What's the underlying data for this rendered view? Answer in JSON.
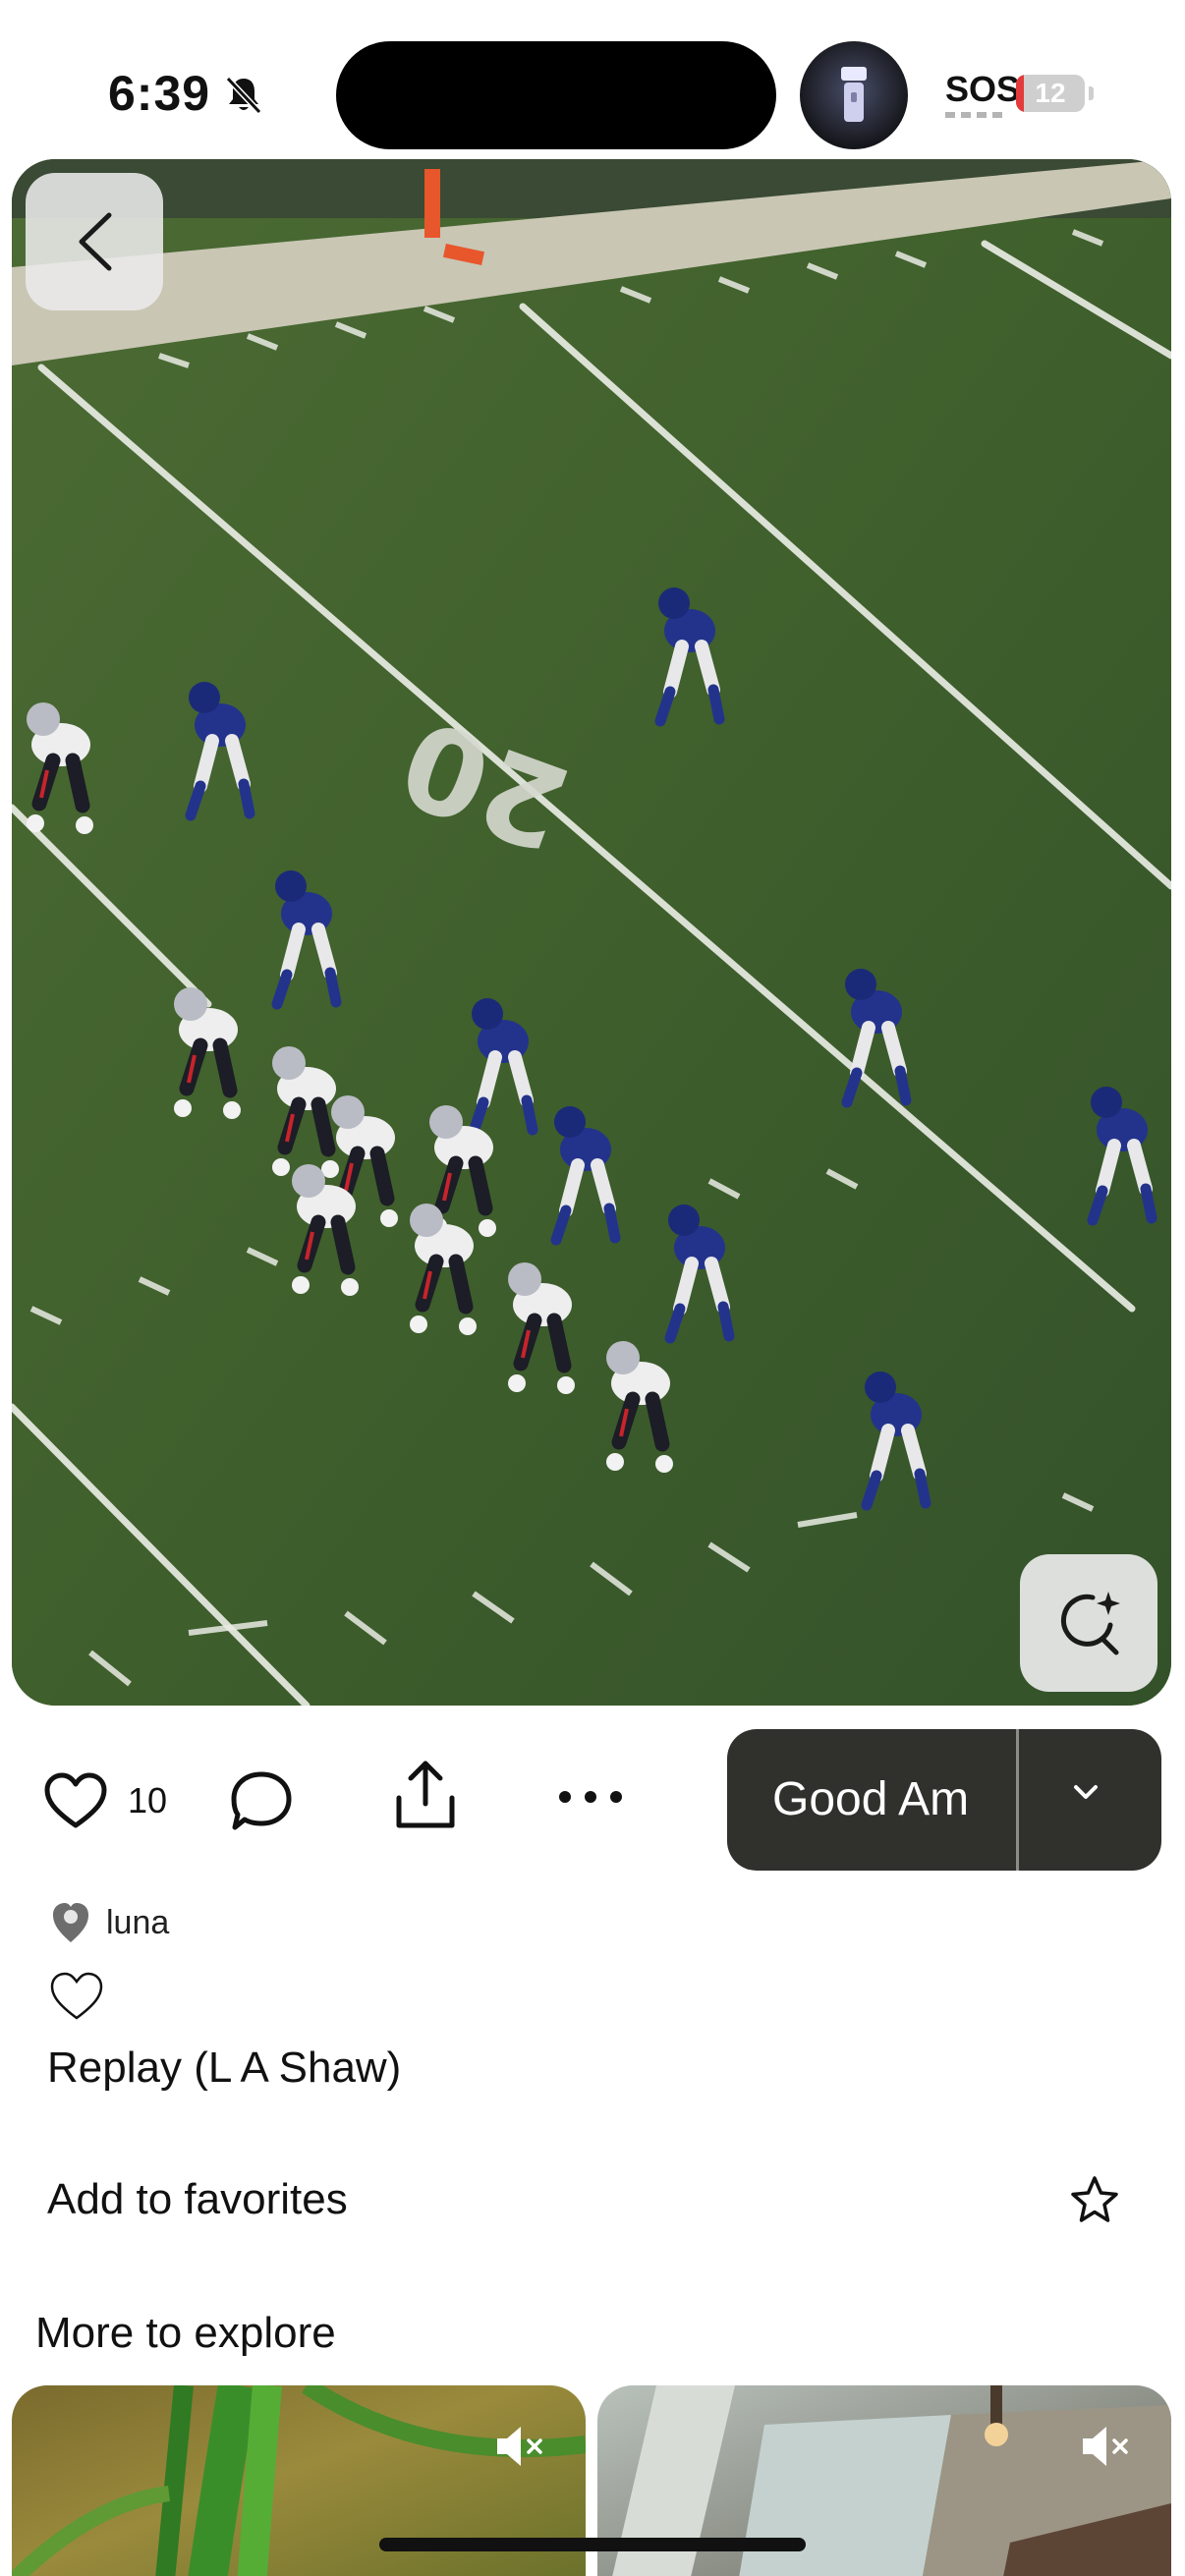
{
  "status_bar": {
    "time": "6:39",
    "silent_icon": "bell-slash-icon",
    "flashlight_icon": "flashlight-icon",
    "sos_label": "SOS",
    "battery_level": "12",
    "battery_fraction": 0.12,
    "battery_color": "#e33b3b"
  },
  "hero": {
    "description_icon": "football-field-photo",
    "yard_number": "20",
    "back_icon": "chevron-left-icon",
    "lens_icon": "visual-search-icon"
  },
  "actions": {
    "like_icon": "heart-outline-icon",
    "like_count": "10",
    "comment_icon": "comment-bubble-icon",
    "share_icon": "share-icon",
    "more_icon": "more-horizontal-icon",
    "sound_title": "Good Am",
    "sound_chevron_icon": "chevron-down-icon",
    "pill_color": "#30302c"
  },
  "creator": {
    "avatar_icon": "avatar",
    "name": "luna"
  },
  "caption": {
    "emoji": "♡",
    "text": "Replay (L A Shaw)"
  },
  "favorites": {
    "label": "Add to favorites",
    "icon": "star-outline-icon"
  },
  "explore": {
    "title": "More to explore",
    "cards": [
      {
        "mute_icon": "speaker-muted-icon"
      },
      {
        "mute_icon": "speaker-muted-icon"
      }
    ]
  }
}
